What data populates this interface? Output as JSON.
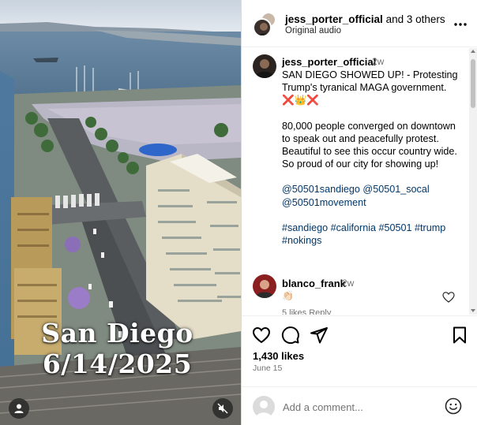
{
  "media": {
    "overlay_line1": "San Diego",
    "overlay_line2": "6/14/2025",
    "user_icon": "user-icon",
    "mute_icon": "speaker-muted-icon"
  },
  "header": {
    "username": "jess_porter_official",
    "others": " and 3 others",
    "subtitle": "Original audio",
    "more_icon": "more-horizontal-icon"
  },
  "caption": {
    "username": "jess_porter_official",
    "time": "2w",
    "line1": "SAN DIEGO SHOWED UP! - Protesting Trump's tyranical MAGA government.",
    "emoji": "❌👑❌",
    "paragraph2": "80,000 people converged on downtown to speak out and peacefully protest. Beautiful to see this occur country wide. So proud of our city for showing up!",
    "mentions": "@50501sandiego @50501_socal @50501movement",
    "hashtags": "#sandiego #california #50501 #trump #nokings"
  },
  "comment": {
    "username": "blanco_frank",
    "time": "2w",
    "text": "👏🏻",
    "meta": "5 likes  Reply"
  },
  "actions": {
    "like_icon": "heart-icon",
    "comment_icon": "comment-icon",
    "share_icon": "send-icon",
    "save_icon": "bookmark-icon"
  },
  "likes": "1,430 likes",
  "date": "June 15",
  "add_comment": {
    "placeholder": "Add a comment...",
    "emoji_icon": "smiley-icon"
  },
  "colors": {
    "link": "#00376b",
    "muted": "#737373",
    "border": "#dbdbdb"
  }
}
